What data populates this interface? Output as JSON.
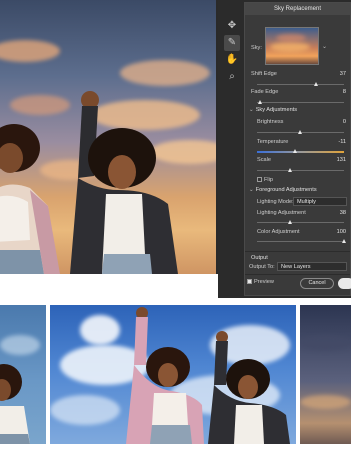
{
  "dialog": {
    "title": "Sky Replacement",
    "sky_label": "Sky:",
    "shift_edge": {
      "label": "Shift Edge",
      "value": "37",
      "level": 0.68
    },
    "fade_edge": {
      "label": "Fade Edge",
      "value": "8",
      "level": 0.04
    },
    "sky_adjustments": {
      "heading": "Sky Adjustments",
      "brightness": {
        "label": "Brightness",
        "value": "0",
        "level": 0.5
      },
      "temperature": {
        "label": "Temperature",
        "value": "-11",
        "level": 0.44
      },
      "scale": {
        "label": "Scale",
        "value": "131",
        "level": 0.38
      },
      "flip_label": "Flip"
    },
    "foreground_adjustments": {
      "heading": "Foreground Adjustments",
      "lighting_mode_label": "Lighting Mode:",
      "lighting_mode_value": "Multiply",
      "lighting_adjustment": {
        "label": "Lighting Adjustment",
        "value": "38",
        "level": 0.38
      },
      "color_adjustment": {
        "label": "Color Adjustment",
        "value": "100",
        "level": 1.0
      }
    },
    "output": {
      "heading": "Output",
      "output_to_label": "Output To:",
      "output_to_value": "New Layers"
    },
    "preview_label": "Preview",
    "cancel_label": "Cancel"
  },
  "tools": [
    "sky-move-tool",
    "sky-brush-tool",
    "hand-tool",
    "zoom-tool"
  ],
  "colors": {
    "panel": "#3a3a3a",
    "panel_dark": "#2b2b2b",
    "text": "#d6d6d6"
  }
}
